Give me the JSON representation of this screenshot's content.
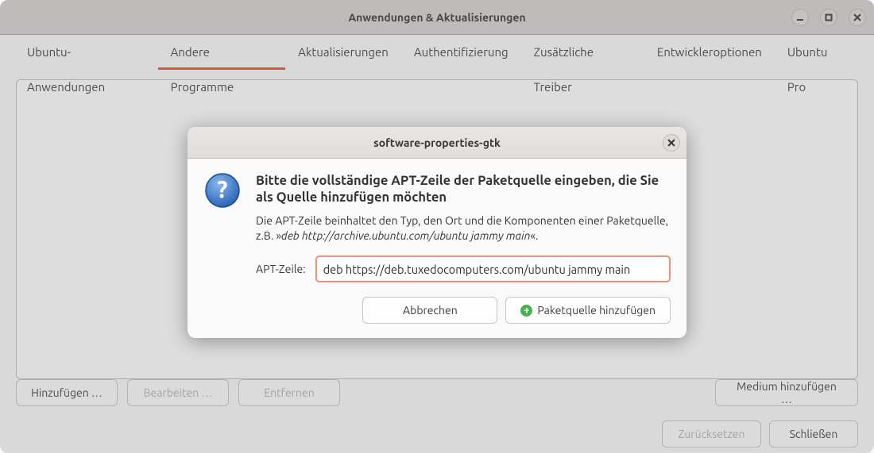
{
  "window": {
    "title": "Anwendungen & Aktualisierungen",
    "controls": {
      "minimize": "minimize-icon",
      "maximize": "maximize-icon",
      "close": "close-icon"
    }
  },
  "tabs": [
    {
      "label": "Ubuntu-Anwendungen",
      "active": false
    },
    {
      "label": "Andere Programme",
      "active": true
    },
    {
      "label": "Aktualisierungen",
      "active": false
    },
    {
      "label": "Authentifizierung",
      "active": false
    },
    {
      "label": "Zusätzliche Treiber",
      "active": false
    },
    {
      "label": "Entwickleroptionen",
      "active": false
    },
    {
      "label": "Ubuntu Pro",
      "active": false
    }
  ],
  "bottom_bar": {
    "add": "Hinzufügen …",
    "edit": "Bearbeiten …",
    "remove": "Entfernen",
    "add_medium": "Medium hinzufügen …"
  },
  "footer": {
    "reset": "Zurücksetzen",
    "close": "Schließen"
  },
  "modal": {
    "title": "software-properties-gtk",
    "heading": "Bitte die vollständige APT-Zeile der Paketquelle eingeben, die Sie als Quelle hinzufügen möchten",
    "description_pre": "Die APT-Zeile beinhaltet den Typ, den Ort und die Komponenten einer Paketquelle, z.B. »",
    "description_example": "deb http://archive.ubuntu.com/ubuntu jammy main",
    "description_post": "«.",
    "apt_label": "APT-Zeile:",
    "apt_value": "deb https://deb.tuxedocomputers.com/ubuntu jammy main",
    "cancel": "Abbrechen",
    "submit": "Paketquelle hinzufügen",
    "icon": "question-icon"
  }
}
